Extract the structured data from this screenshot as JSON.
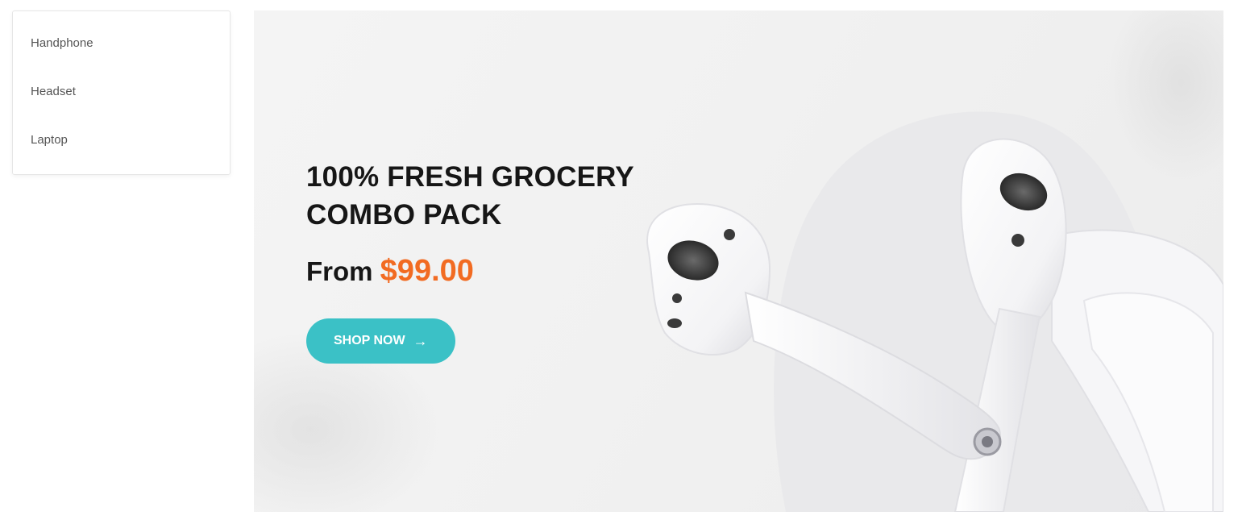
{
  "categories": [
    {
      "label": "Handphone"
    },
    {
      "label": "Headset"
    },
    {
      "label": "Laptop"
    }
  ],
  "hero": {
    "title_line1": "100% FRESH GROCERY",
    "title_line2": "COMBO PACK",
    "price_prefix": "From",
    "price_value": "$99.00",
    "button_label": "SHOP NOW",
    "button_icon": "arrow-right-icon",
    "image": "white-wireless-earbuds-with-case"
  },
  "colors": {
    "accent_teal": "#3bc1c6",
    "price_orange": "#f26b22",
    "title_dark": "#161616"
  }
}
